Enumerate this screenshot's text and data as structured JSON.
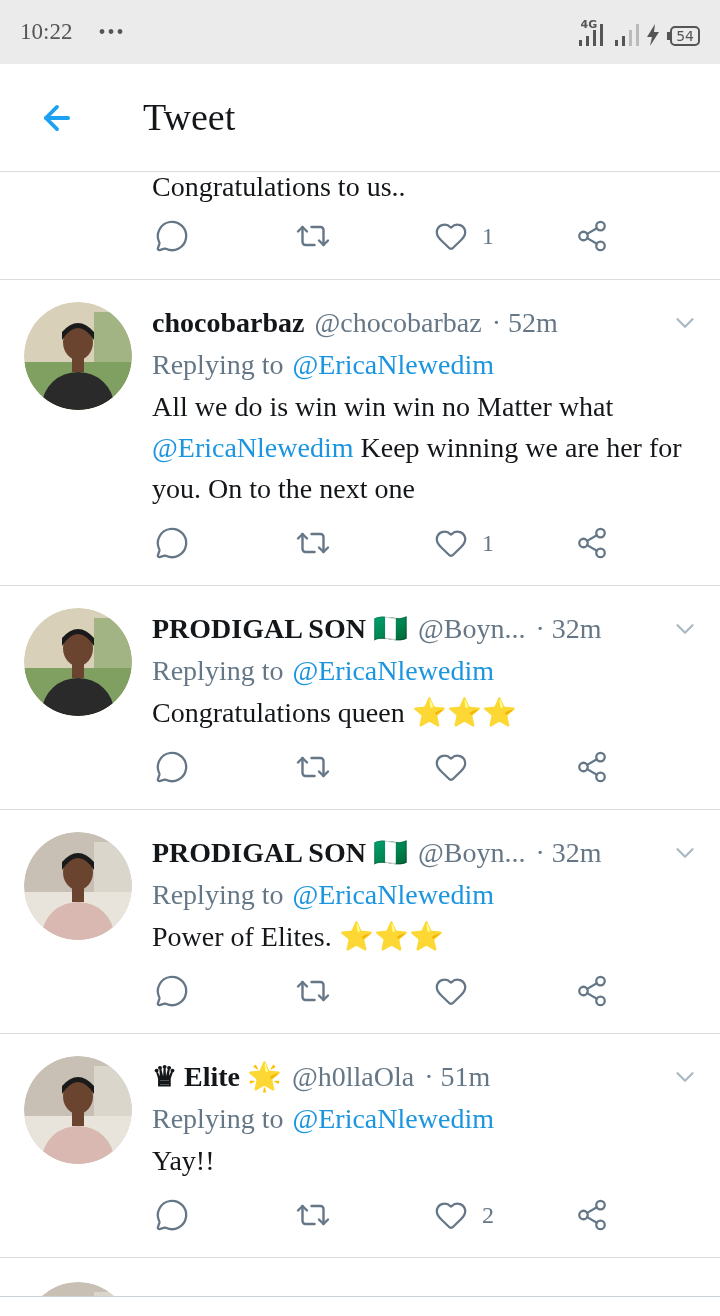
{
  "status_bar": {
    "time": "10:22",
    "dots": "•••",
    "network": "4G",
    "battery": "54"
  },
  "header": {
    "title": "Tweet"
  },
  "partial_tweet": {
    "text": "Congratulations to us..",
    "likes": "1"
  },
  "tweets": [
    {
      "name": "chocobarbaz",
      "handle": "@chocobarbaz",
      "time": "· 52m",
      "replying_label": "Replying to",
      "reply_to": "@EricaNlewedim",
      "text": [
        {
          "kind": "plain",
          "text": "All we do is win win win no Matter what"
        },
        {
          "kind": "mention",
          "text": "@EricaNlewedim"
        },
        {
          "kind": "plain",
          "text": "Keep winning we are her for you. On to the next one"
        }
      ],
      "likes": "1"
    },
    {
      "name": "PRODIGAL SON 🇳🇬",
      "handle": "@Boyn...",
      "time": "· 32m",
      "replying_label": "Replying to",
      "reply_to": "@EricaNlewedim",
      "text": [
        {
          "kind": "plain",
          "text": "Congratulations queen ⭐⭐⭐"
        }
      ]
    },
    {
      "name": "PRODIGAL SON 🇳🇬",
      "handle": "@Boyn...",
      "time": "· 32m",
      "replying_label": "Replying to",
      "reply_to": "@EricaNlewedim",
      "text": [
        {
          "kind": "plain",
          "text": "Power of Elites. ⭐⭐⭐"
        }
      ]
    },
    {
      "name": "♛ Elite 🌟",
      "handle": "@h0llaOla",
      "time": "· 51m",
      "replying_label": "Replying to",
      "reply_to": "@EricaNlewedim",
      "text": [
        {
          "kind": "plain",
          "text": "Yay!!"
        }
      ],
      "likes": "2"
    }
  ]
}
